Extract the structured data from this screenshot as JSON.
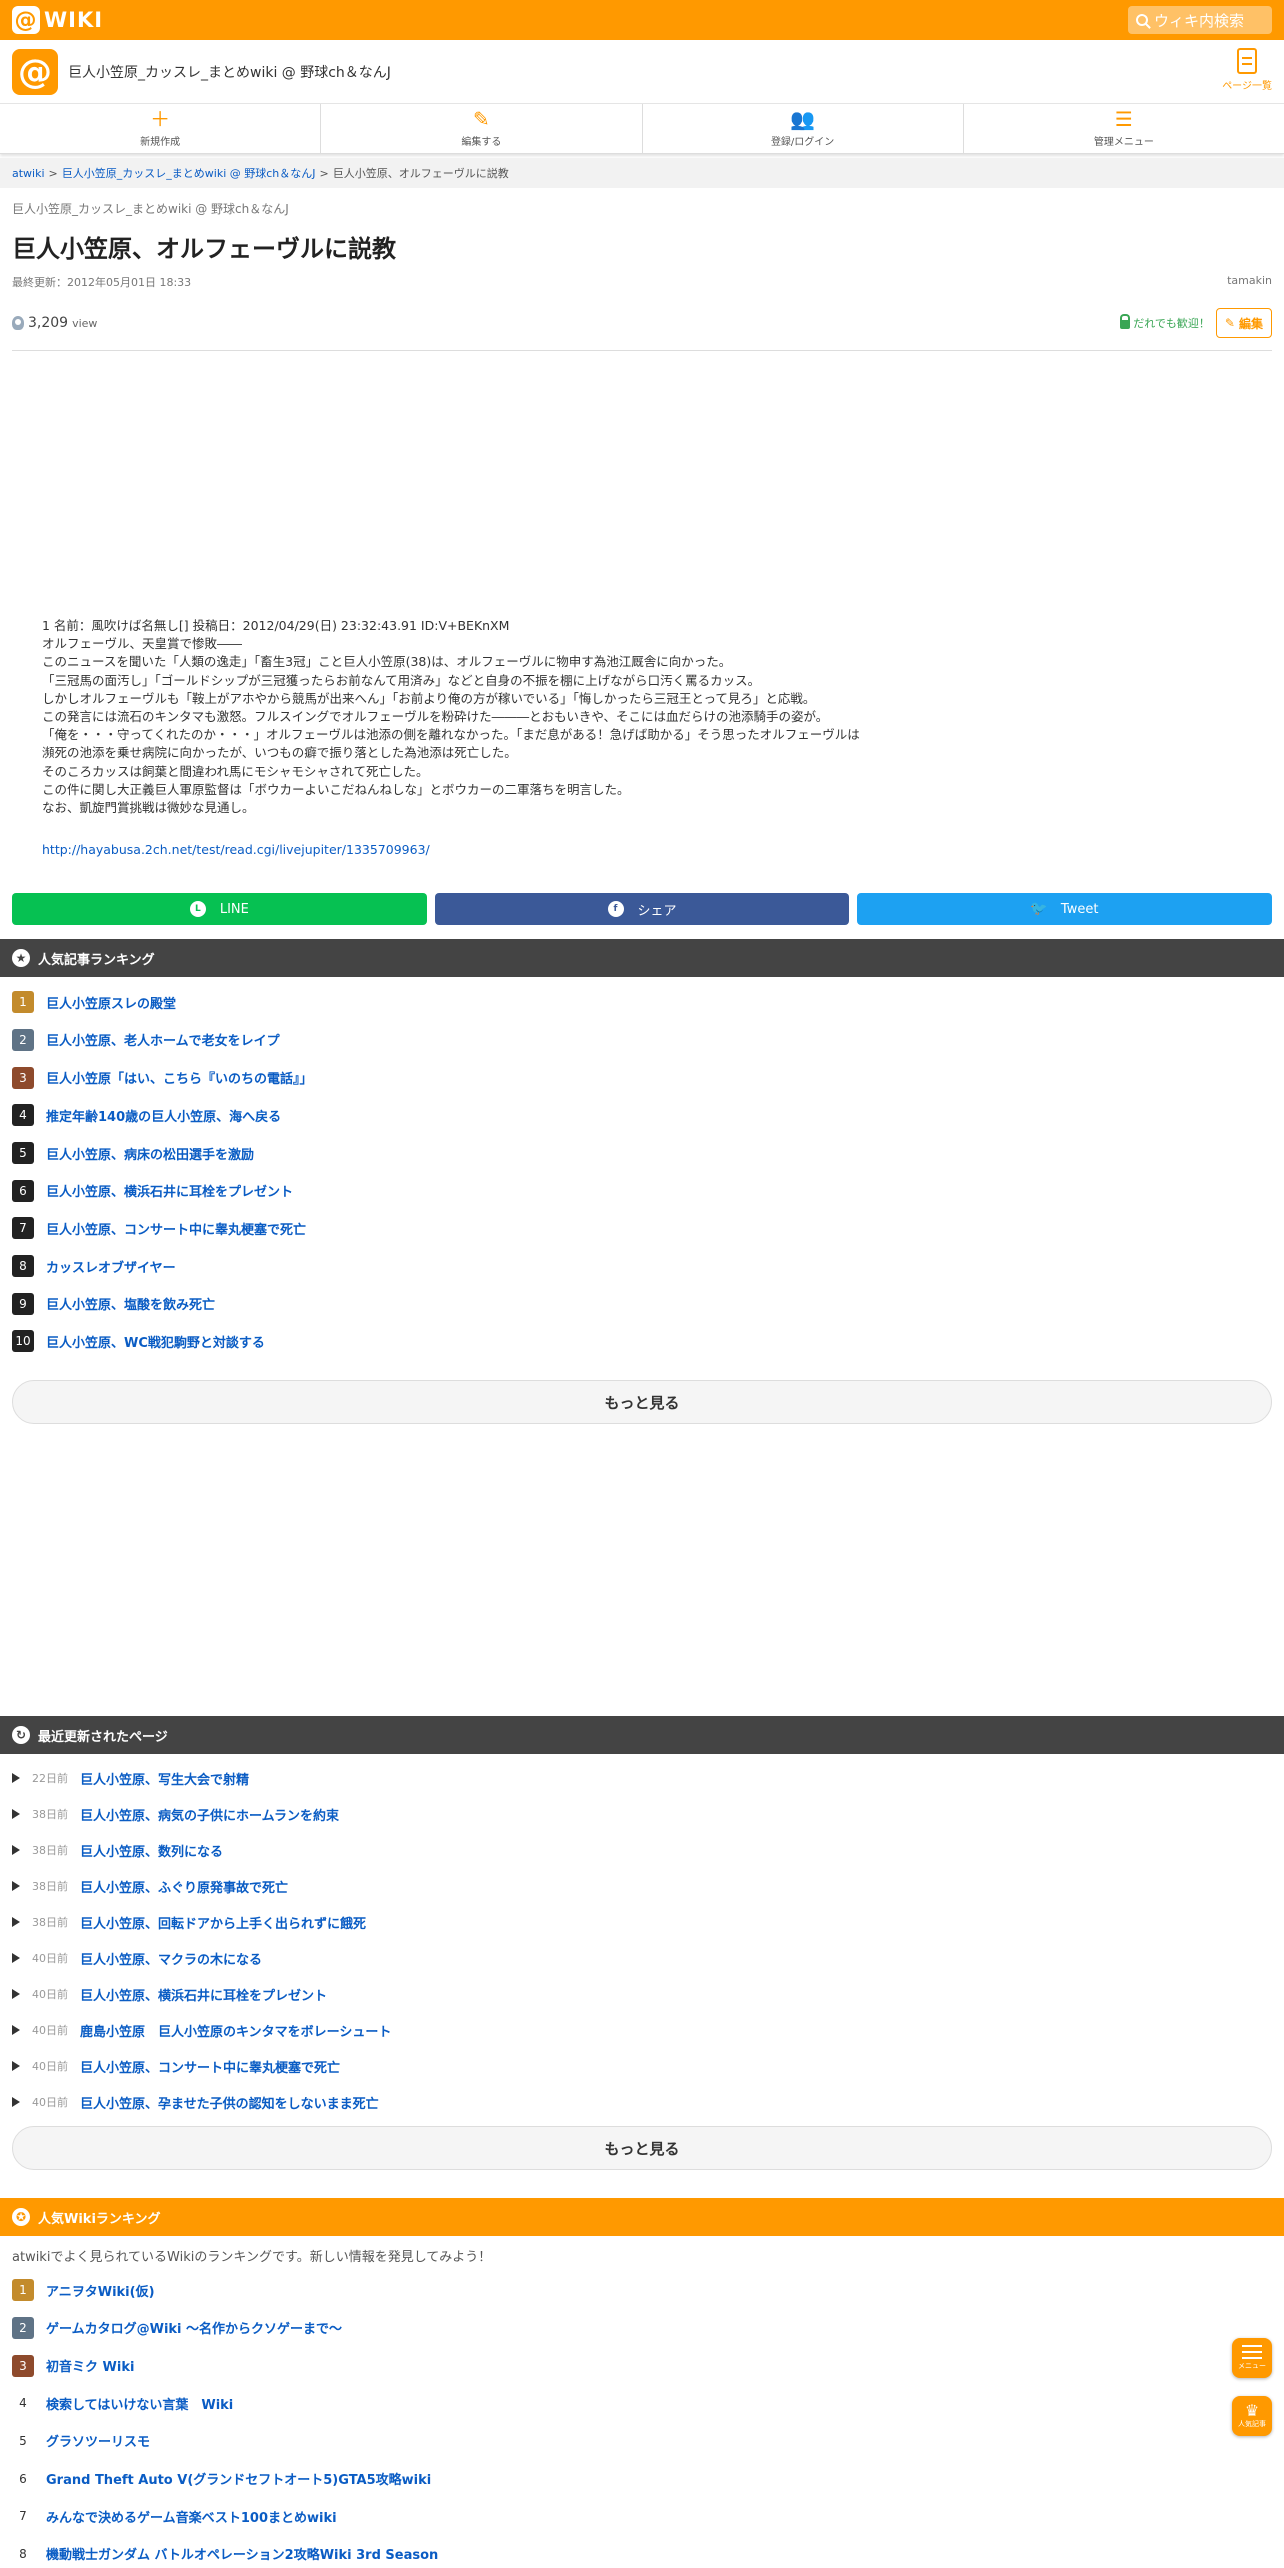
{
  "topbar": {
    "logo_text": "WIKI",
    "search_placeholder": "ウィキ内検索"
  },
  "site": {
    "name": "巨人小笠原_カッスレ_まとめwiki @ 野球ch＆なんJ",
    "page_list_label": "ページ一覧"
  },
  "nav": [
    {
      "label": "新規作成",
      "icon": "plus-icon"
    },
    {
      "label": "編集する",
      "icon": "pencil-icon"
    },
    {
      "label": "登録/ログイン",
      "icon": "user-add-icon"
    },
    {
      "label": "管理メニュー",
      "icon": "settings-icon"
    }
  ],
  "breadcrumb": {
    "home": "atwiki",
    "sep": ">",
    "site": "巨人小笠原_カッスレ_まとめwiki @ 野球ch＆なんJ",
    "current": "巨人小笠原、オルフェーヴルに説教"
  },
  "article": {
    "site_sub": "巨人小笠原_カッスレ_まとめwiki @ 野球ch＆なんJ",
    "title": "巨人小笠原、オルフェーヴルに説教",
    "last_updated": "最終更新：2012年05月01日 18:33",
    "author": "tamakin",
    "views": "3,209",
    "views_unit": "view",
    "welcome": "だれでも歓迎！",
    "edit_label": "編集",
    "lines": [
      "1 名前：風吹けば名無し[] 投稿日：2012/04/29(日) 23:32:43.91 ID:V+BEKnXM",
      "オルフェーヴル、天皇賞で惨敗――",
      "このニュースを聞いた「人類の逸走」「畜生3冠」こと巨人小笠原(38)は、オルフェーヴルに物申す為池江厩舎に向かった。",
      "「三冠馬の面汚し」「ゴールドシップが三冠獲ったらお前なんて用済み」などと自身の不振を棚に上げながら口汚く罵るカッス。",
      "しかしオルフェーヴルも「鞍上がアホやから競馬が出来へん」「お前より俺の方が稼いでいる」「悔しかったら三冠王とって見ろ」と応戦。",
      "この発言には流石のキンタマも激怒。フルスイングでオルフェーヴルを粉砕けた―――とおもいきや、そこには血だらけの池添騎手の姿が。",
      "「俺を・・・守ってくれたのか・・・」オルフェーヴルは池添の側を離れなかった。「まだ息がある！急げば助かる」そう思ったオルフェーヴルは",
      "瀕死の池添を乗せ病院に向かったが、いつもの癖で振り落とした為池添は死亡した。",
      "そのころカッスは飼葉と間違われ馬にモシャモシャされて死亡した。",
      "この件に関し大正義巨人軍原監督は「ボウカーよいこだねんねしな」とボウカーの二軍落ちを明言した。",
      "なお、凱旋門賞挑戦は微妙な見通し。"
    ],
    "source_link": "http://hayabusa.2ch.net/test/read.cgi/livejupiter/1335709963/"
  },
  "share": {
    "line": "LINE",
    "facebook": "シェア",
    "twitter": "Tweet"
  },
  "ranking": {
    "title": "人気記事ランキング",
    "items": [
      "巨人小笠原スレの殿堂",
      "巨人小笠原、老人ホームで老女をレイプ",
      "巨人小笠原「はい、こちら『いのちの電話』」",
      "推定年齢140歳の巨人小笠原、海へ戻る",
      "巨人小笠原、病床の松田選手を激励",
      "巨人小笠原、横浜石井に耳栓をプレゼント",
      "巨人小笠原、コンサート中に睾丸梗塞で死亡",
      "カッスレオブザイヤー",
      "巨人小笠原、塩酸を飲み死亡",
      "巨人小笠原、WC戦犯駒野と対談する"
    ],
    "more": "もっと見る"
  },
  "recent": {
    "title": "最近更新されたページ",
    "items": [
      {
        "days": "22日前",
        "title": "巨人小笠原、写生大会で射精"
      },
      {
        "days": "38日前",
        "title": "巨人小笠原、病気の子供にホームランを約束"
      },
      {
        "days": "38日前",
        "title": "巨人小笠原、数列になる"
      },
      {
        "days": "38日前",
        "title": "巨人小笠原、ふぐり原発事故で死亡"
      },
      {
        "days": "38日前",
        "title": "巨人小笠原、回転ドアから上手く出られずに餓死"
      },
      {
        "days": "40日前",
        "title": "巨人小笠原、マクラの木になる"
      },
      {
        "days": "40日前",
        "title": "巨人小笠原、横浜石井に耳栓をプレゼント"
      },
      {
        "days": "40日前",
        "title": "鹿島小笠原　巨人小笠原のキンタマをボレーシュート"
      },
      {
        "days": "40日前",
        "title": "巨人小笠原、コンサート中に睾丸梗塞で死亡"
      },
      {
        "days": "40日前",
        "title": "巨人小笠原、孕ませた子供の認知をしないまま死亡"
      }
    ],
    "more": "もっと見る"
  },
  "wiki_ranking": {
    "title": "人気Wikiランキング",
    "intro": "atwikiでよく見られているWikiのランキングです。新しい情報を発見してみよう！",
    "items": [
      "アニヲタWiki(仮)",
      "ゲームカタログ@Wiki ～名作からクソゲーまで～",
      "初音ミク Wiki",
      "検索してはいけない言葉　Wiki",
      "グラソツーリスモ",
      "Grand Theft Auto V(グランドセフトオート5)GTA5攻略wiki",
      "みんなで決めるゲーム音楽ベスト100まとめwiki",
      "機動戦士ガンダム バトルオペレーション2攻略Wiki 3rd Season"
    ]
  },
  "floating": {
    "menu": "メニュー",
    "popular": "人気記事"
  }
}
